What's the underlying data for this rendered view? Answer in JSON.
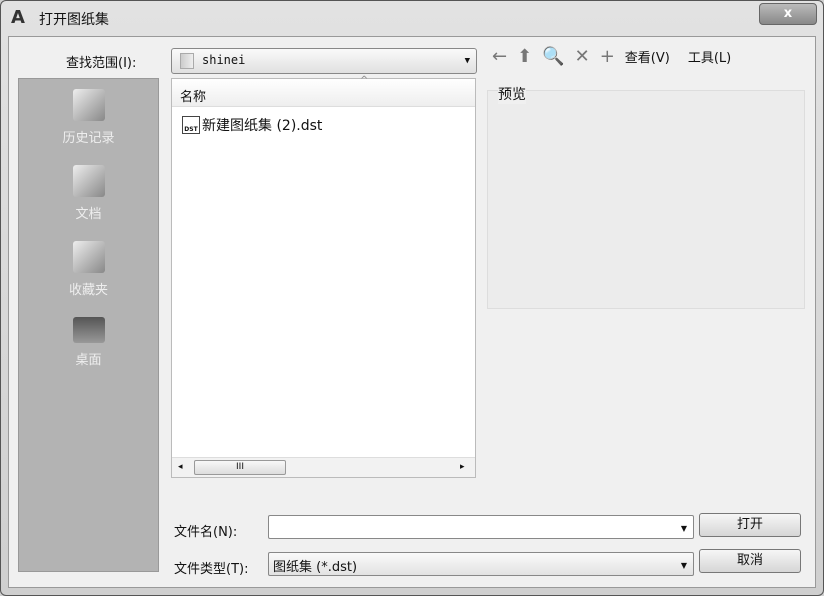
{
  "window": {
    "title": "打开图纸集",
    "logo": "A",
    "close": "x"
  },
  "lookin": {
    "label": "查找范围(I):",
    "value": "shinei"
  },
  "toolbar": {
    "back": "←",
    "up": "⬆",
    "search_web": "🔍",
    "delete": "✕",
    "new_folder": "+",
    "views": "查看(V)",
    "tools": "工具(L)"
  },
  "sidebar": [
    {
      "label": "历史记录"
    },
    {
      "label": "文档"
    },
    {
      "label": "收藏夹"
    },
    {
      "label": "桌面"
    }
  ],
  "list": {
    "column": "名称",
    "files": [
      {
        "name": "新建图纸集 (2).dst",
        "icon": "DST"
      }
    ],
    "scroll_thumb": "III"
  },
  "preview": {
    "label": "预览"
  },
  "filename": {
    "label": "文件名(N):",
    "value": ""
  },
  "filetype": {
    "label": "文件类型(T):",
    "value": "图纸集 (*.dst)"
  },
  "buttons": {
    "open": "打开",
    "cancel": "取消"
  }
}
